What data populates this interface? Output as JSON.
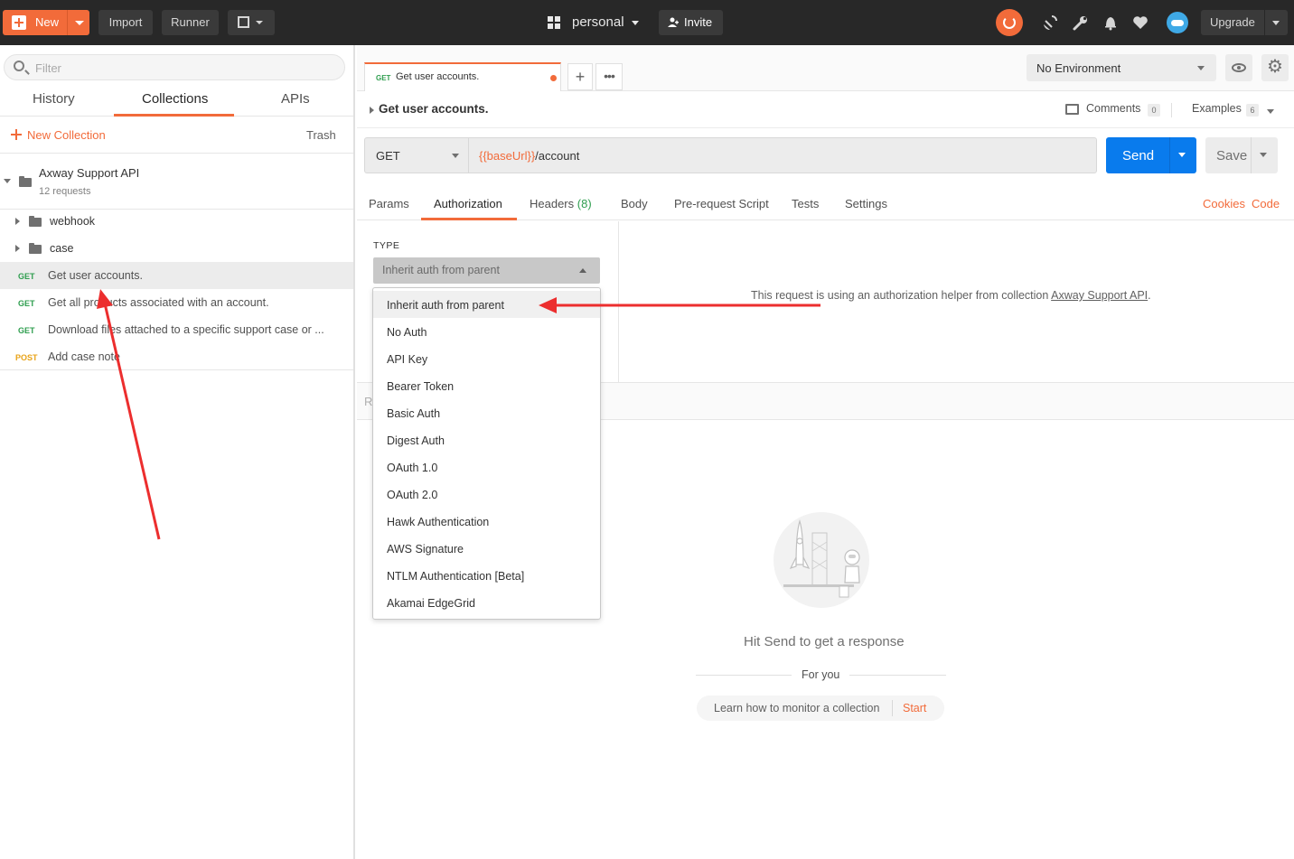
{
  "topbar": {
    "new_label": "New",
    "import_label": "Import",
    "runner_label": "Runner",
    "workspace_label": "personal",
    "invite_label": "Invite",
    "upgrade_label": "Upgrade",
    "icons": [
      "sync-icon",
      "satellite-icon",
      "wrench-icon",
      "bell-icon",
      "heart-icon",
      "cloud-icon"
    ],
    "accent_color": "#f26b3a"
  },
  "sidebar": {
    "filter_placeholder": "Filter",
    "tabs": [
      "History",
      "Collections",
      "APIs"
    ],
    "active_tab": "Collections",
    "new_collection_label": "New Collection",
    "trash_label": "Trash",
    "collection": {
      "name": "Axway Support API",
      "count": "12 requests"
    },
    "folders": [
      "webhook",
      "case"
    ],
    "requests": [
      {
        "method": "GET",
        "label": "Get user accounts."
      },
      {
        "method": "GET",
        "label": "Get all products associated with an account."
      },
      {
        "method": "GET",
        "label": "Download files attached to a specific support case or ..."
      },
      {
        "method": "POST",
        "label": "Add case note"
      }
    ]
  },
  "tabs": {
    "active_method": "GET",
    "active_title": "Get user accounts.",
    "add_label": "+",
    "more_label": "•••"
  },
  "env": {
    "selected": "No Environment"
  },
  "request": {
    "name": "Get user accounts.",
    "comments_label": "Comments",
    "comments_count": "0",
    "examples_label": "Examples",
    "examples_count": "6",
    "method": "GET",
    "url_var": "{{baseUrl}}",
    "url_path": "/account",
    "send_label": "Send",
    "save_label": "Save"
  },
  "req_tabs": {
    "params": "Params",
    "authorization": "Authorization",
    "headers": "Headers",
    "headers_count": "(8)",
    "body": "Body",
    "prerequest": "Pre-request Script",
    "tests": "Tests",
    "settings": "Settings",
    "cookies": "Cookies",
    "code": "Code"
  },
  "auth": {
    "type_label": "TYPE",
    "selected": "Inherit auth from parent",
    "help_prefix": "This request is using an authorization helper from collection ",
    "help_link": "Axway Support API",
    "help_suffix": ".",
    "options": [
      "Inherit auth from parent",
      "No Auth",
      "API Key",
      "Bearer Token",
      "Basic Auth",
      "Digest Auth",
      "OAuth 1.0",
      "OAuth 2.0",
      "Hawk Authentication",
      "AWS Signature",
      "NTLM Authentication [Beta]",
      "Akamai EdgeGrid"
    ]
  },
  "response": {
    "header_label": "R",
    "empty_title": "Hit Send to get a response",
    "for_you": "For you",
    "learn_label": "Learn how to monitor a collection",
    "start_label": "Start"
  }
}
